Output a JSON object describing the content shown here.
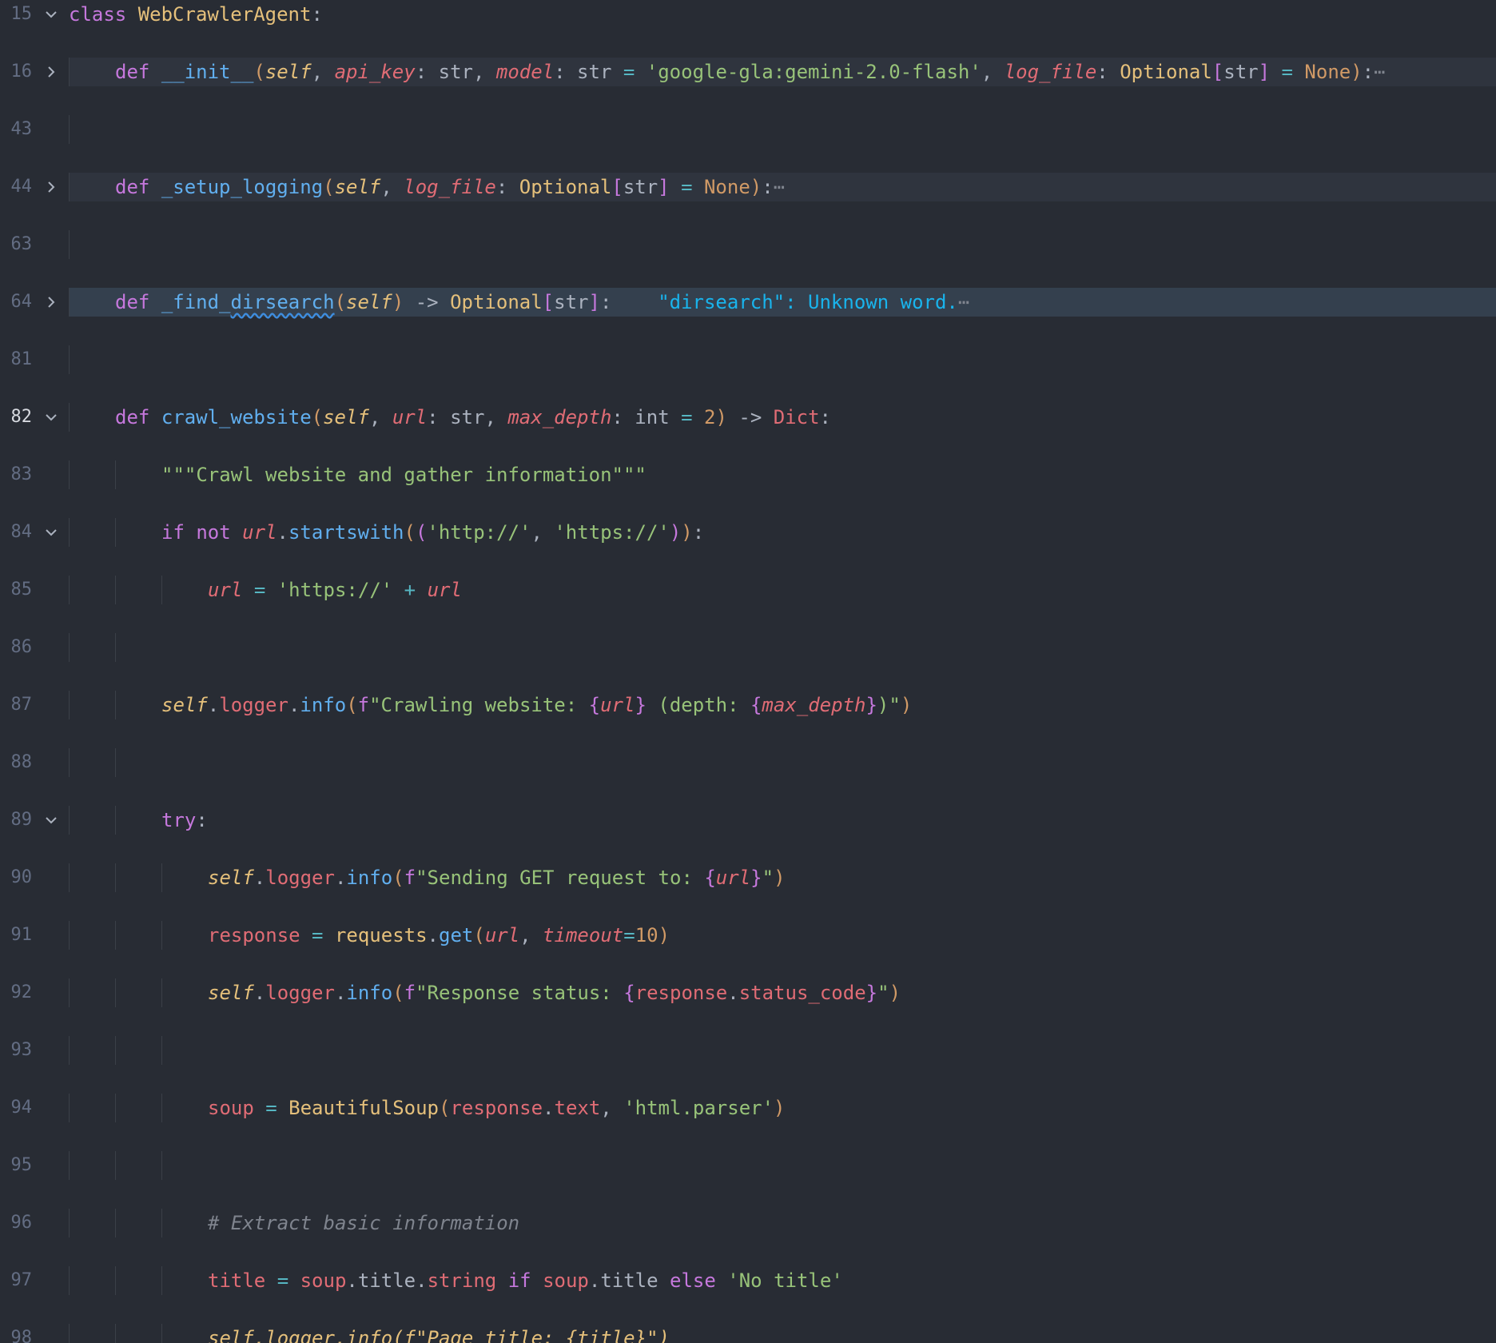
{
  "editor": {
    "lines": [
      {
        "num": "15"
      },
      {
        "num": "16"
      },
      {
        "num": "43"
      },
      {
        "num": "44"
      },
      {
        "num": "63"
      },
      {
        "num": "64"
      },
      {
        "num": "81"
      },
      {
        "num": "82"
      },
      {
        "num": "83"
      },
      {
        "num": "84"
      },
      {
        "num": "85"
      },
      {
        "num": "86"
      },
      {
        "num": "87"
      },
      {
        "num": "88"
      },
      {
        "num": "89"
      },
      {
        "num": "90"
      },
      {
        "num": "91"
      },
      {
        "num": "92"
      },
      {
        "num": "93"
      },
      {
        "num": "94"
      },
      {
        "num": "95"
      },
      {
        "num": "96"
      },
      {
        "num": "97"
      },
      {
        "num": "98"
      }
    ],
    "l15": {
      "kw": "class",
      "name": "WebCrawlerAgent",
      "colon": ":"
    },
    "l16": {
      "def": "def",
      "fn": "__init__",
      "self": "self",
      "p1": "api_key",
      "p2": "model",
      "p3": "log_file",
      "t_str": "str",
      "default_model": "'google-gla:gemini-2.0-flash'",
      "t_opt": "Optional",
      "none": "None",
      "ellipsis": "⋯"
    },
    "l44": {
      "def": "def",
      "fn": "_setup_logging",
      "self": "self",
      "p1": "log_file",
      "t_opt": "Optional",
      "t_str": "str",
      "none": "None",
      "ellipsis": "⋯"
    },
    "l64": {
      "def": "def",
      "fn": "_find_",
      "fn_sq": "dirsearch",
      "self": "self",
      "t_opt": "Optional",
      "t_str": "str",
      "diagnostic": "\"dirsearch\": Unknown word.",
      "ellipsis": "⋯"
    },
    "l82": {
      "def": "def",
      "fn": "crawl_website",
      "self": "self",
      "p1": "url",
      "t_str": "str",
      "p2": "max_depth",
      "t_int": "int",
      "default": "2",
      "ret": "Dict"
    },
    "l83": {
      "docstring": "\"\"\"Crawl website and gather information\"\"\""
    },
    "l84": {
      "kw_if": "if",
      "kw_not": "not",
      "var": "url",
      "method": "startswith",
      "s1": "'http://'",
      "s2": "'https://'"
    },
    "l85": {
      "var": "url",
      "s": "'https://'",
      "var2": "url"
    },
    "l87": {
      "self": "self",
      "attr": "logger",
      "method": "info",
      "f": "f",
      "s_a": "\"Crawling website: ",
      "v1": "url",
      "s_b": " (depth: ",
      "v2": "max_depth",
      "s_c": ")\""
    },
    "l89": {
      "kw": "try"
    },
    "l90": {
      "self": "self",
      "attr": "logger",
      "method": "info",
      "f": "f",
      "s_a": "\"Sending GET request to: ",
      "v1": "url",
      "s_c": "\""
    },
    "l91": {
      "var": "response",
      "mod": "requests",
      "method": "get",
      "arg": "url",
      "kwarg": "timeout",
      "num": "10"
    },
    "l92": {
      "self": "self",
      "attr": "logger",
      "method": "info",
      "f": "f",
      "s_a": "\"Response status: ",
      "v1": "response",
      "v1b": "status_code",
      "s_c": "\""
    },
    "l94": {
      "var": "soup",
      "cls": "BeautifulSoup",
      "arg": "response",
      "arg_attr": "text",
      "s": "'html.parser'"
    },
    "l96": {
      "comment": "# Extract basic information"
    },
    "l97": {
      "var": "title",
      "obj": "soup",
      "a1": "title",
      "a2": "string",
      "kw_if": "if",
      "obj2": "soup",
      "a3": "title",
      "kw_else": "else",
      "s": "'No title'"
    },
    "l98": {
      "partial": "self.logger.info(f\"Page title: {title}\")"
    }
  }
}
